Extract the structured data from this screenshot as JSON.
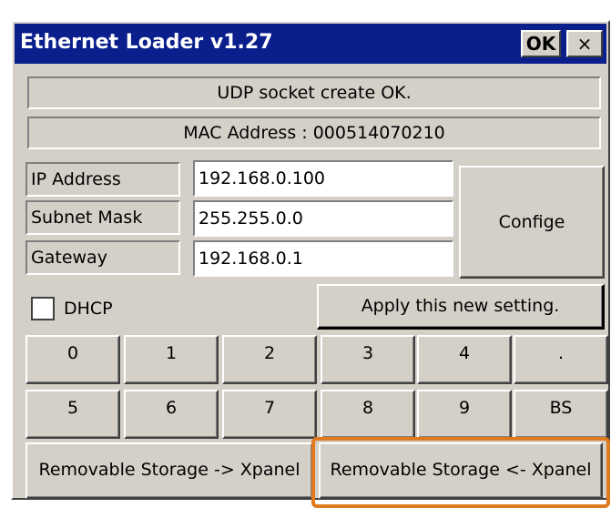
{
  "window": {
    "title": "Ethernet Loader v1.27",
    "ok_label": "OK",
    "close_label": "×"
  },
  "status": {
    "message": "UDP socket create OK.",
    "mac": "MAC Address : 000514070210"
  },
  "fields": [
    {
      "label": "IP Address",
      "value": "192.168.0.100"
    },
    {
      "label": "Subnet Mask",
      "value": "255.255.0.0"
    },
    {
      "label": "Gateway",
      "value": "192.168.0.1"
    }
  ],
  "config_label": "Confige",
  "dhcp": {
    "label": "DHCP",
    "checked": false
  },
  "apply_label": "Apply this new setting.",
  "keypad": {
    "row1": [
      "0",
      "1",
      "2",
      "3",
      "4",
      "."
    ],
    "row2": [
      "5",
      "6",
      "7",
      "8",
      "9",
      "BS"
    ]
  },
  "storage": {
    "to_xpanel": "Removable Storage -> Xpanel",
    "from_xpanel": "Removable Storage <- Xpanel"
  },
  "colors": {
    "titlebar": "#0a1e8c",
    "face": "#d4d0c8",
    "highlight": "#e07a1f"
  }
}
